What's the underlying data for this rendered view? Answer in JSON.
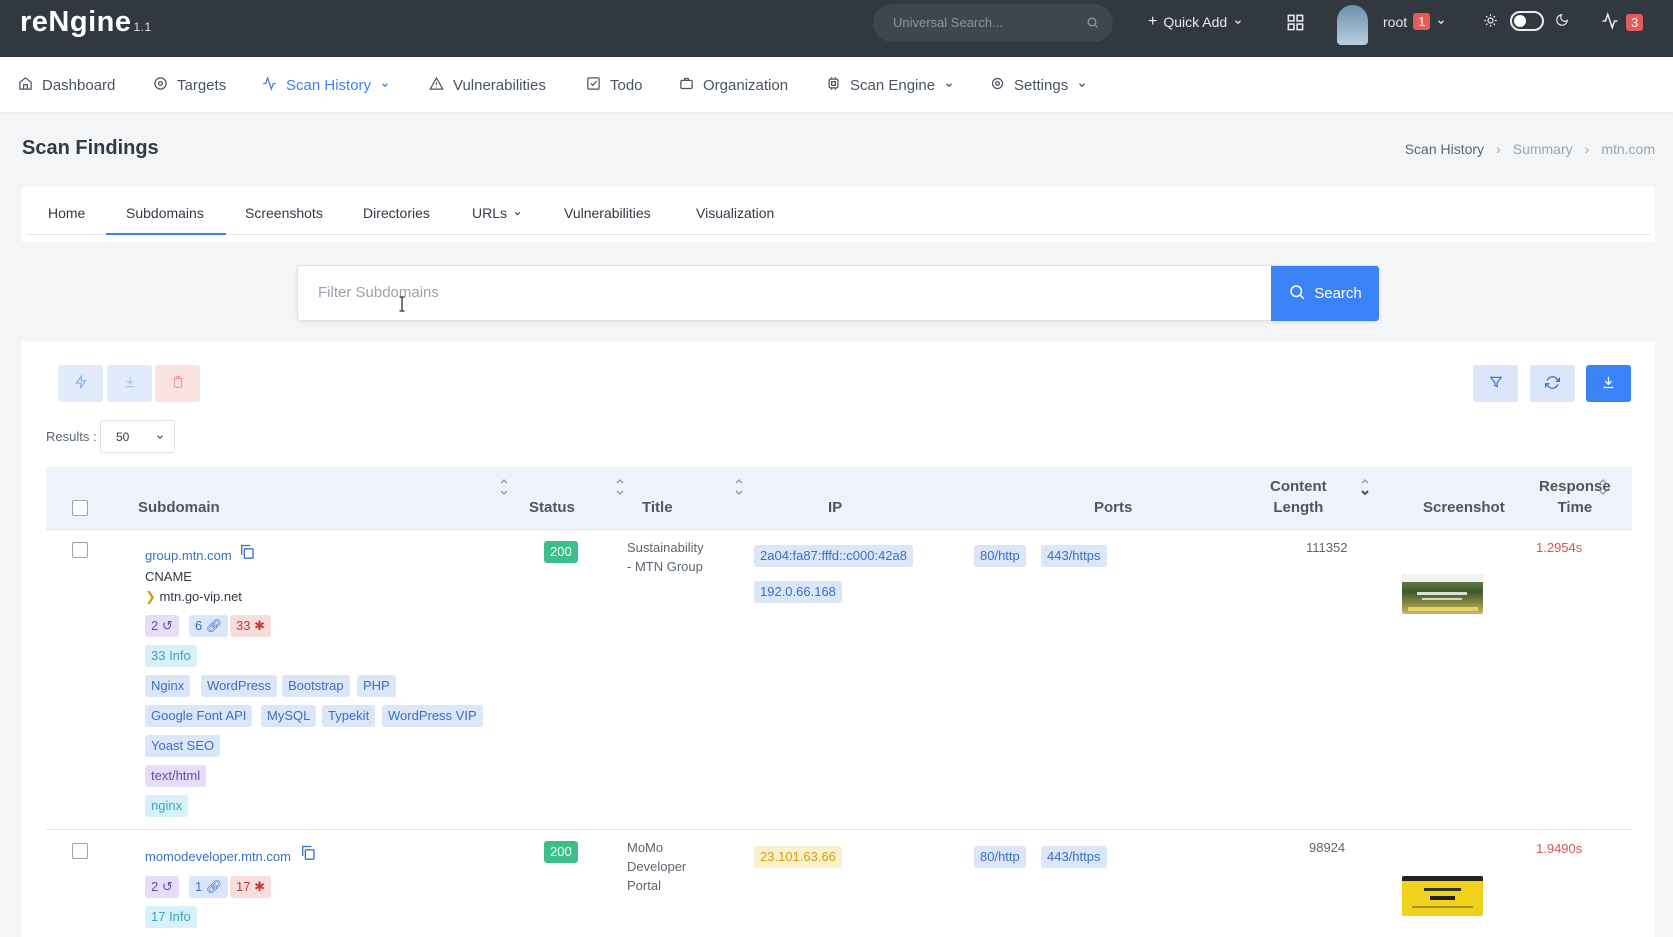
{
  "app": {
    "name": "reNgine",
    "version": "1.1"
  },
  "topbar": {
    "search_placeholder": "Universal Search...",
    "quick_add": "Quick Add",
    "user": "root",
    "user_badge": "1",
    "activity_badge": "3"
  },
  "nav": [
    {
      "label": "Dashboard",
      "icon": "home-icon"
    },
    {
      "label": "Targets",
      "icon": "target-icon"
    },
    {
      "label": "Scan History",
      "icon": "activity-icon",
      "active": true
    },
    {
      "label": "Vulnerabilities",
      "icon": "alert-triangle-icon"
    },
    {
      "label": "Todo",
      "icon": "check-square-icon"
    },
    {
      "label": "Organization",
      "icon": "briefcase-icon"
    },
    {
      "label": "Scan Engine",
      "icon": "cpu-icon"
    },
    {
      "label": "Settings",
      "icon": "settings-icon"
    }
  ],
  "page": {
    "title": "Scan Findings",
    "breadcrumb": [
      "Scan History",
      "Summary",
      "mtn.com"
    ]
  },
  "tabs": [
    "Home",
    "Subdomains",
    "Screenshots",
    "Directories",
    "URLs",
    "Vulnerabilities",
    "Visualization"
  ],
  "active_tab": "Subdomains",
  "filter": {
    "placeholder": "Filter Subdomains",
    "button": "Search"
  },
  "results": {
    "label": "Results :",
    "value": "50"
  },
  "table": {
    "headers": {
      "subdomain": "Subdomain",
      "status": "Status",
      "title": "Title",
      "ip": "IP",
      "ports": "Ports",
      "content_length_1": "Content",
      "content_length_2": "Length",
      "screenshot": "Screenshot",
      "response_time_1": "Response",
      "response_time_2": "Time"
    },
    "rows": [
      {
        "subdomain": "group.mtn.com",
        "cname_label": "CNAME",
        "cname": "mtn.go-vip.net",
        "counts": {
          "history": "2",
          "links": "6",
          "vulns": "33"
        },
        "info": "33 Info",
        "tech": [
          "Nginx",
          "WordPress",
          "Bootstrap",
          "PHP",
          "Google Font API",
          "MySQL",
          "Typekit",
          "WordPress VIP",
          "Yoast SEO"
        ],
        "content_type": "text/html",
        "webserver": "nginx",
        "status": "200",
        "title_1": "Sustainability",
        "title_2": "- MTN Group",
        "ips": [
          "2a04:fa87:fffd::c000:42a8",
          "192.0.66.168"
        ],
        "ports": [
          "80/http",
          "443/https"
        ],
        "content_length": "111352",
        "response_time": "1.2954s"
      },
      {
        "subdomain": "momodeveloper.mtn.com",
        "counts": {
          "history": "2",
          "links": "1",
          "vulns": "17"
        },
        "info": "17 Info",
        "status": "200",
        "title_1": "MoMo",
        "title_2": "Developer",
        "title_3": "Portal",
        "ips": [
          "23.101.63.66"
        ],
        "ports": [
          "80/http",
          "443/https"
        ],
        "content_length": "98924",
        "response_time": "1.9490s"
      }
    ]
  }
}
